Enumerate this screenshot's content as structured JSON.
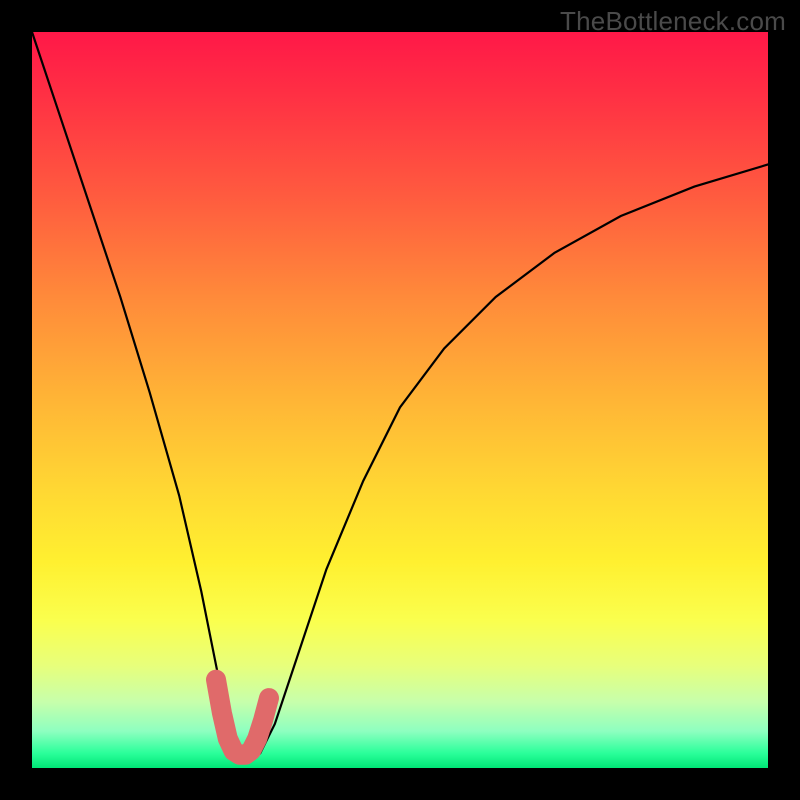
{
  "watermark": "TheBottleneck.com",
  "chart_data": {
    "type": "line",
    "title": "",
    "xlabel": "",
    "ylabel": "",
    "xlim": [
      0,
      100
    ],
    "ylim": [
      0,
      100
    ],
    "series": [
      {
        "name": "curve",
        "x": [
          0,
          4,
          8,
          12,
          16,
          20,
          23,
          25,
          27,
          29,
          31,
          33,
          36,
          40,
          45,
          50,
          56,
          63,
          71,
          80,
          90,
          100
        ],
        "y": [
          100,
          88,
          76,
          64,
          51,
          37,
          24,
          14,
          4,
          2,
          2,
          6,
          15,
          27,
          39,
          49,
          57,
          64,
          70,
          75,
          79,
          82
        ]
      }
    ],
    "highlight": {
      "name": "marker-segment",
      "color": "#e06a6a",
      "x": [
        25.0,
        25.8,
        26.6,
        27.4,
        28.2,
        29.0,
        29.8,
        30.6,
        31.4,
        32.2
      ],
      "y": [
        12.0,
        7.5,
        4.0,
        2.3,
        1.8,
        1.8,
        2.4,
        4.0,
        6.5,
        9.5
      ]
    }
  }
}
